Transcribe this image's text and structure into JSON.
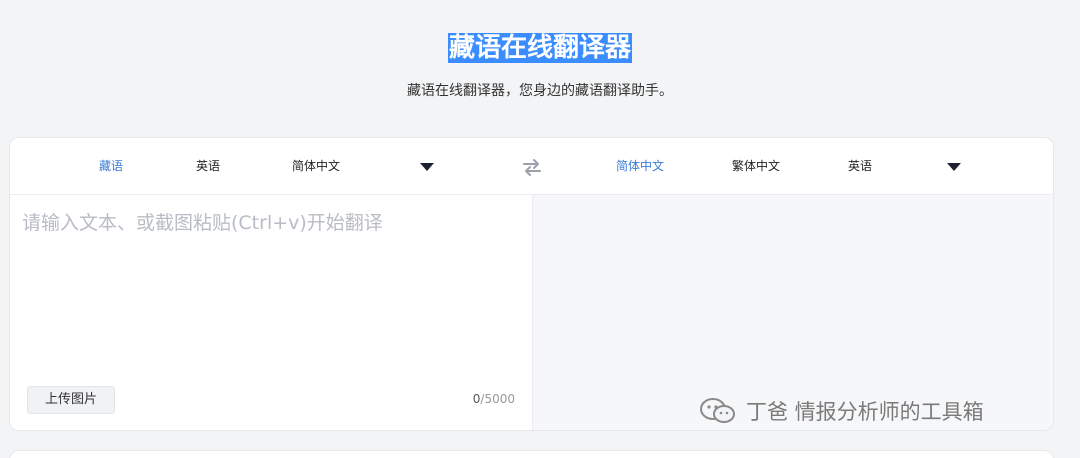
{
  "header": {
    "title": "藏语在线翻译器",
    "subtitle": "藏语在线翻译器，您身边的藏语翻译助手。"
  },
  "source_langs": {
    "items": [
      "藏语",
      "英语",
      "简体中文"
    ],
    "active": "藏语"
  },
  "target_langs": {
    "items": [
      "简体中文",
      "繁体中文",
      "英语"
    ],
    "active": "简体中文"
  },
  "input": {
    "value": "",
    "placeholder": "请输入文本、或截图粘贴(Ctrl+v)开始翻译"
  },
  "upload_label": "上传图片",
  "char_count": {
    "current": "0",
    "max": "/5000"
  },
  "watermark": {
    "text": "丁爸 情报分析师的工具箱"
  },
  "colors": {
    "accent": "#3a7bd5",
    "title_highlight": "#3b8cff",
    "page_bg": "#f3f4f6"
  }
}
